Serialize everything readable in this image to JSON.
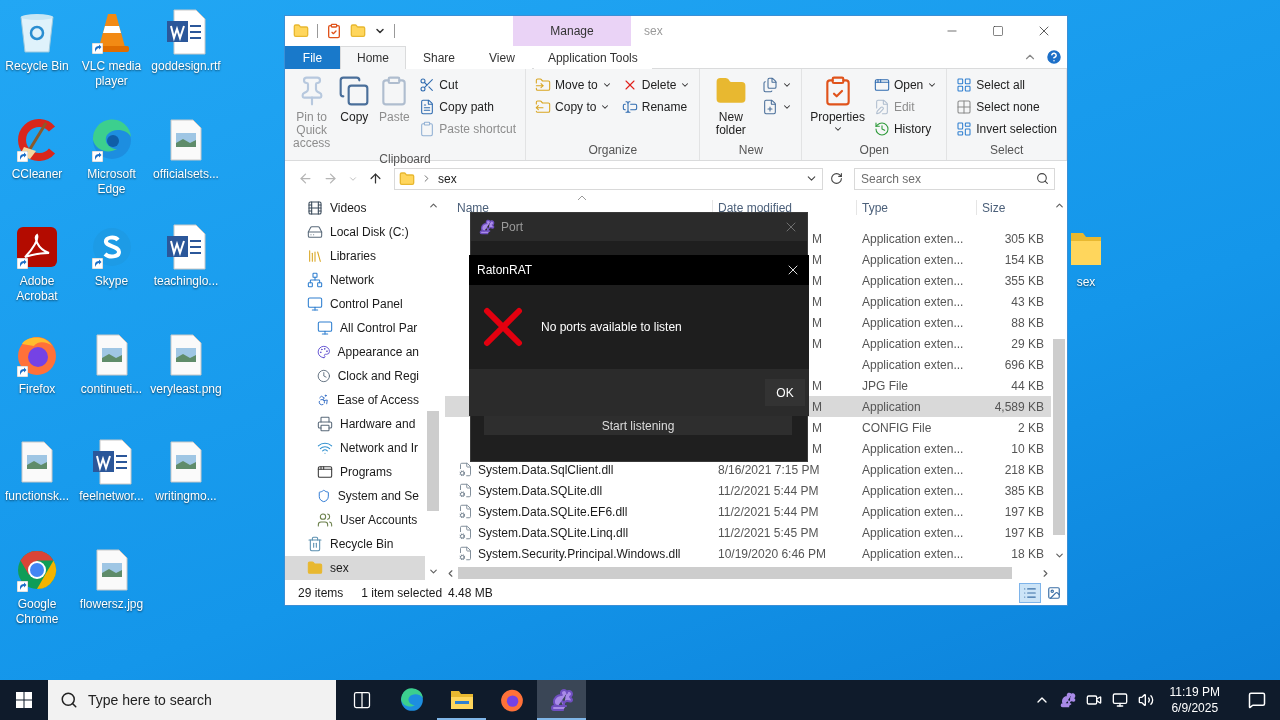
{
  "desktop": {
    "icons": [
      {
        "label": "Recycle Bin",
        "kind": "recycle",
        "shortcut": false
      },
      {
        "label": "CCleaner",
        "kind": "ccleaner",
        "shortcut": true
      },
      {
        "label": "Adobe Acrobat",
        "kind": "acrobat",
        "shortcut": true
      },
      {
        "label": "Firefox",
        "kind": "firefox",
        "shortcut": true
      },
      {
        "label": "functionsk...",
        "kind": "image",
        "shortcut": false
      },
      {
        "label": "Google Chrome",
        "kind": "chrome",
        "shortcut": true
      },
      {
        "label": "VLC media player",
        "kind": "vlc",
        "shortcut": true
      },
      {
        "label": "Microsoft Edge",
        "kind": "edge",
        "shortcut": true
      },
      {
        "label": "Skype",
        "kind": "skype",
        "shortcut": true
      },
      {
        "label": "continueti...",
        "kind": "image",
        "shortcut": false
      },
      {
        "label": "feelnetwor...",
        "kind": "word",
        "shortcut": false
      },
      {
        "label": "flowersz.jpg",
        "kind": "image",
        "shortcut": false
      },
      {
        "label": "goddesign.rtf",
        "kind": "word",
        "shortcut": false
      },
      {
        "label": "officialsets...",
        "kind": "image",
        "shortcut": false
      },
      {
        "label": "teachinglo...",
        "kind": "word",
        "shortcut": false
      },
      {
        "label": "veryleast.png",
        "kind": "image",
        "shortcut": false
      },
      {
        "label": "writingmo...",
        "kind": "image",
        "shortcut": false
      }
    ],
    "side_icon": {
      "label": "sex",
      "kind": "folder",
      "shortcut": false
    }
  },
  "explorer": {
    "title": "sex",
    "context_header": "Manage",
    "tabs": [
      {
        "label": "File",
        "kind": "file",
        "selected": false
      },
      {
        "label": "Home",
        "kind": "tab",
        "selected": true
      },
      {
        "label": "Share",
        "kind": "tab",
        "selected": false
      },
      {
        "label": "View",
        "kind": "tab",
        "selected": false
      },
      {
        "label": "Application Tools",
        "kind": "context",
        "selected": false
      }
    ],
    "ribbon": [
      {
        "label": "Clipboard",
        "items": [
          {
            "kind": "pin",
            "label": "Pin to Quick access",
            "disabled": true
          },
          {
            "kind": "copy",
            "label": "Copy",
            "disabled": false
          },
          {
            "kind": "paste",
            "label": "Paste",
            "disabled": true
          },
          {
            "stack": [
              {
                "label": "Cut",
                "kind": "cut",
                "disabled": false
              },
              {
                "label": "Copy path",
                "kind": "copy-path",
                "disabled": false
              },
              {
                "label": "Paste shortcut",
                "kind": "paste-shortcut",
                "disabled": true
              }
            ]
          }
        ]
      },
      {
        "label": "Organize",
        "items": [
          {
            "stack": [
              {
                "label": "Move to",
                "kind": "move",
                "disabled": false,
                "dropdown": true
              },
              {
                "label": "Copy to",
                "kind": "copy-to",
                "disabled": false,
                "dropdown": true
              }
            ]
          },
          {
            "stack": [
              {
                "label": "Delete",
                "kind": "delete",
                "disabled": false,
                "dropdown": true
              },
              {
                "label": "Rename",
                "kind": "rename",
                "disabled": false,
                "dropdown": false
              }
            ]
          }
        ]
      },
      {
        "label": "New",
        "items": [
          {
            "kind": "new-folder",
            "label": "New folder",
            "disabled": false
          },
          {
            "stack": [
              {
                "kind": "new-item",
                "disabled": false,
                "dropdown": true
              },
              {
                "kind": "easy-access",
                "disabled": false,
                "dropdown": true
              }
            ]
          }
        ]
      },
      {
        "label": "Open",
        "items": [
          {
            "kind": "properties",
            "label": "Properties",
            "disabled": false,
            "dropdown": true
          },
          {
            "stack": [
              {
                "label": "Open",
                "kind": "open",
                "disabled": false,
                "dropdown": true
              },
              {
                "label": "Edit",
                "kind": "edit",
                "disabled": true,
                "dropdown": false
              },
              {
                "label": "History",
                "kind": "history",
                "disabled": false,
                "dropdown": false
              }
            ]
          }
        ]
      },
      {
        "label": "Select",
        "items": [
          {
            "stack": [
              {
                "label": "Select all",
                "kind": "select-all",
                "disabled": false
              },
              {
                "label": "Select none",
                "kind": "select-none",
                "disabled": false
              },
              {
                "label": "Invert selection",
                "kind": "invert",
                "disabled": false
              }
            ]
          }
        ]
      }
    ],
    "address": {
      "path": "sex",
      "search_placeholder": "Search sex"
    },
    "nav_tree": [
      {
        "children": [
          {
            "label": "Videos",
            "kind": "videos",
            "selected": false
          },
          {
            "label": "Local Disk (C:)",
            "kind": "drive",
            "selected": false
          }
        ]
      },
      {
        "label": "Libraries",
        "kind": "libraries",
        "selected": false
      },
      {
        "label": "Network",
        "kind": "network",
        "selected": false
      },
      {
        "label": "Control Panel",
        "kind": "control-panel",
        "selected": false,
        "children": [
          {
            "label": "All Control Par",
            "kind": "control-panel",
            "selected": false
          },
          {
            "label": "Appearance an",
            "kind": "appearance",
            "selected": false
          },
          {
            "label": "Clock and Regi",
            "kind": "clock",
            "selected": false
          },
          {
            "label": "Ease of Access",
            "kind": "ease",
            "selected": false
          },
          {
            "label": "Hardware and",
            "kind": "hardware",
            "selected": false
          },
          {
            "label": "Network and Ir",
            "kind": "internet",
            "selected": false
          },
          {
            "label": "Programs",
            "kind": "programs",
            "selected": false
          },
          {
            "label": "System and Se",
            "kind": "system",
            "selected": false
          },
          {
            "label": "User Accounts",
            "kind": "users",
            "selected": false
          }
        ]
      },
      {
        "label": "Recycle Bin",
        "kind": "recycle",
        "selected": false
      },
      {
        "label": "sex",
        "kind": "folder",
        "selected": true
      }
    ],
    "columns": [
      {
        "label": "Name"
      },
      {
        "label": "Date modified"
      },
      {
        "label": "Type"
      },
      {
        "label": "Size"
      }
    ],
    "rows": [
      {
        "kind": "covered",
        "date": "M",
        "type": "Application exten...",
        "size": "305 KB",
        "selected": false
      },
      {
        "kind": "covered",
        "date": "M",
        "type": "Application exten...",
        "size": "154 KB",
        "selected": false
      },
      {
        "kind": "covered",
        "date": "M",
        "type": "Application exten...",
        "size": "355 KB",
        "selected": false
      },
      {
        "kind": "covered",
        "date": "M",
        "type": "Application exten...",
        "size": "43 KB",
        "selected": false
      },
      {
        "kind": "covered",
        "date": "M",
        "type": "Application exten...",
        "size": "88 KB",
        "selected": false
      },
      {
        "kind": "covered",
        "date": "M",
        "type": "Application exten...",
        "size": "29 KB",
        "selected": false
      },
      {
        "kind": "covered",
        "type": "Application exten...",
        "size": "696 KB",
        "selected": false
      },
      {
        "kind": "covered",
        "date": "M",
        "type": "JPG File",
        "size": "44 KB",
        "selected": false
      },
      {
        "kind": "covered",
        "date": "M",
        "type": "Application",
        "size": "4,589 KB",
        "selected": true
      },
      {
        "kind": "covered",
        "date": "M",
        "type": "CONFIG File",
        "size": "2 KB",
        "selected": false
      },
      {
        "kind": "covered",
        "date": "M",
        "type": "Application exten...",
        "size": "10 KB",
        "selected": false
      },
      {
        "kind": "dll",
        "name": "System.Data.SqlClient.dll",
        "date": "8/16/2021 7:15 PM",
        "type": "Application exten...",
        "size": "218 KB",
        "selected": false
      },
      {
        "kind": "dll",
        "name": "System.Data.SQLite.dll",
        "date": "11/2/2021 5:44 PM",
        "type": "Application exten...",
        "size": "385 KB",
        "selected": false
      },
      {
        "kind": "dll",
        "name": "System.Data.SQLite.EF6.dll",
        "date": "11/2/2021 5:44 PM",
        "type": "Application exten...",
        "size": "197 KB",
        "selected": false
      },
      {
        "kind": "dll",
        "name": "System.Data.SQLite.Linq.dll",
        "date": "11/2/2021 5:45 PM",
        "type": "Application exten...",
        "size": "197 KB",
        "selected": false
      },
      {
        "kind": "dll",
        "name": "System.Security.Principal.Windows.dll",
        "date": "10/19/2020 6:46 PM",
        "type": "Application exten...",
        "size": "18 KB",
        "selected": false
      }
    ],
    "status": {
      "count": "29 items",
      "selection": "1 item selected",
      "size": "4.48 MB",
      "views": [
        {
          "kind": "details",
          "selected": true
        },
        {
          "kind": "large-icons",
          "selected": false
        }
      ]
    }
  },
  "port_dialog": {
    "title": "Port",
    "button": "Start listening"
  },
  "message_dialog": {
    "title": "RatonRAT",
    "kind": "error",
    "message": "No ports available to listen",
    "button": "OK"
  },
  "taskbar": {
    "search_placeholder": "Type here to search",
    "apps": [
      {
        "kind": "task-view",
        "running": false,
        "selected": false
      },
      {
        "kind": "edge",
        "running": false,
        "selected": false
      },
      {
        "kind": "explorer",
        "running": true,
        "selected": false
      },
      {
        "kind": "firefox",
        "running": false,
        "selected": false
      },
      {
        "kind": "rat",
        "running": true,
        "selected": true
      }
    ],
    "time": "11:19 PM",
    "date": "6/9/2025"
  }
}
